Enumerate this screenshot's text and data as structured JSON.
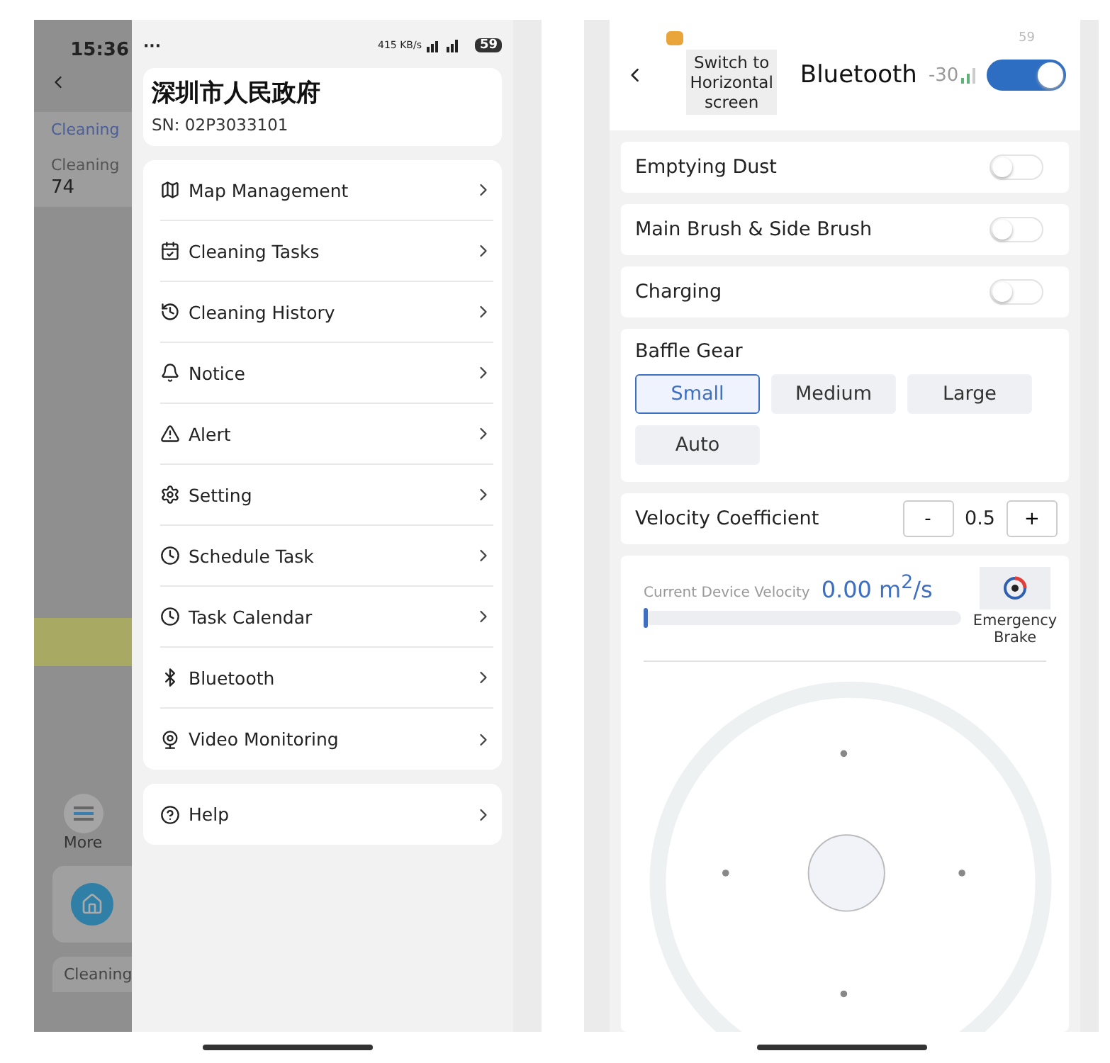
{
  "left_phone": {
    "status": {
      "time": "15:36",
      "more": "···",
      "speed": "415 KB/s",
      "battery": "59"
    },
    "map": {
      "status": "Cleaning",
      "stat_label": "Cleaning",
      "stat_value": "74",
      "more": "More",
      "bottom": "Cleaning"
    },
    "drawer": {
      "title": "深圳市人民政府",
      "sn": "SN:  02P3033101",
      "menu": [
        {
          "kind": "map",
          "label": "Map Management"
        },
        {
          "kind": "calendar",
          "label": "Cleaning Tasks"
        },
        {
          "kind": "history",
          "label": "Cleaning History"
        },
        {
          "kind": "bell",
          "label": "Notice"
        },
        {
          "kind": "alert",
          "label": "Alert"
        },
        {
          "kind": "gear",
          "label": "Setting"
        },
        {
          "kind": "clock",
          "label": "Schedule Task"
        },
        {
          "kind": "clock",
          "label": "Task Calendar"
        },
        {
          "kind": "bluetooth",
          "label": "Bluetooth"
        },
        {
          "kind": "camera",
          "label": "Video Monitoring"
        }
      ],
      "help": {
        "kind": "help",
        "label": "Help"
      }
    }
  },
  "right_phone": {
    "header": {
      "battery": "59",
      "switch": "Switch to Horizontal screen",
      "title": "Bluetooth",
      "signal": "-30",
      "on": true
    },
    "toggles": [
      {
        "label": "Emptying Dust",
        "on": false
      },
      {
        "label": "Main Brush & Side Brush",
        "on": false
      },
      {
        "label": "Charging",
        "on": false
      }
    ],
    "baffle": {
      "title": "Baffle Gear",
      "options": [
        {
          "label": "Small",
          "selected": true
        },
        {
          "label": "Medium",
          "selected": false
        },
        {
          "label": "Large",
          "selected": false
        },
        {
          "label": "Auto",
          "selected": false
        }
      ]
    },
    "velocity": {
      "label": "Velocity Coefficient",
      "minus": "-",
      "value": "0.5",
      "plus": "+"
    },
    "device": {
      "label": "Current Device Velocity",
      "value": "0.00 m$^{2}$/s",
      "level": 0.01,
      "brake": "Emergency Brake"
    }
  }
}
